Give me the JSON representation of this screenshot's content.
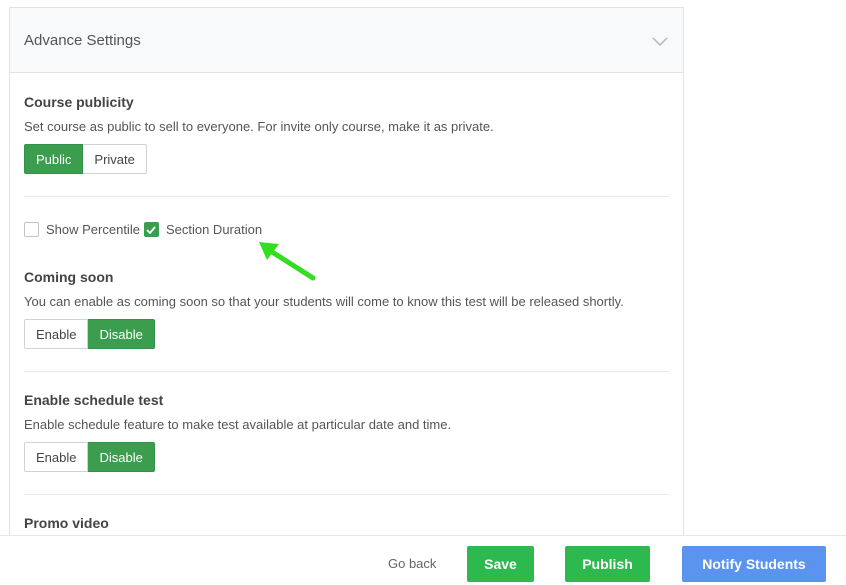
{
  "panel": {
    "title": "Advance Settings"
  },
  "course_publicity": {
    "title": "Course publicity",
    "description": "Set course as public to sell to everyone. For invite only course, make it as private.",
    "options": [
      "Public",
      "Private"
    ],
    "selected": "Public"
  },
  "checkboxes": {
    "show_percentile": {
      "label": "Show Percentile",
      "checked": false
    },
    "section_duration": {
      "label": "Section Duration",
      "checked": true
    }
  },
  "coming_soon": {
    "title": "Coming soon",
    "description": "You can enable as coming soon so that your students will come to know this test will be released shortly.",
    "options": [
      "Enable",
      "Disable"
    ],
    "selected": "Disable"
  },
  "schedule_test": {
    "title": "Enable schedule test",
    "description": "Enable schedule feature to make test available at particular date and time.",
    "options": [
      "Enable",
      "Disable"
    ],
    "selected": "Disable"
  },
  "promo_video": {
    "title": "Promo video"
  },
  "footer": {
    "go_back": "Go back",
    "save": "Save",
    "publish": "Publish",
    "notify": "Notify Students"
  },
  "colors": {
    "green": "#3c9d4e",
    "save_green": "#2eb94f",
    "blue": "#5b94ee",
    "arrow": "#33dd22"
  },
  "icons": {
    "collapse": "chevron-down-icon",
    "check": "check-icon",
    "annotation": "arrow-icon"
  }
}
